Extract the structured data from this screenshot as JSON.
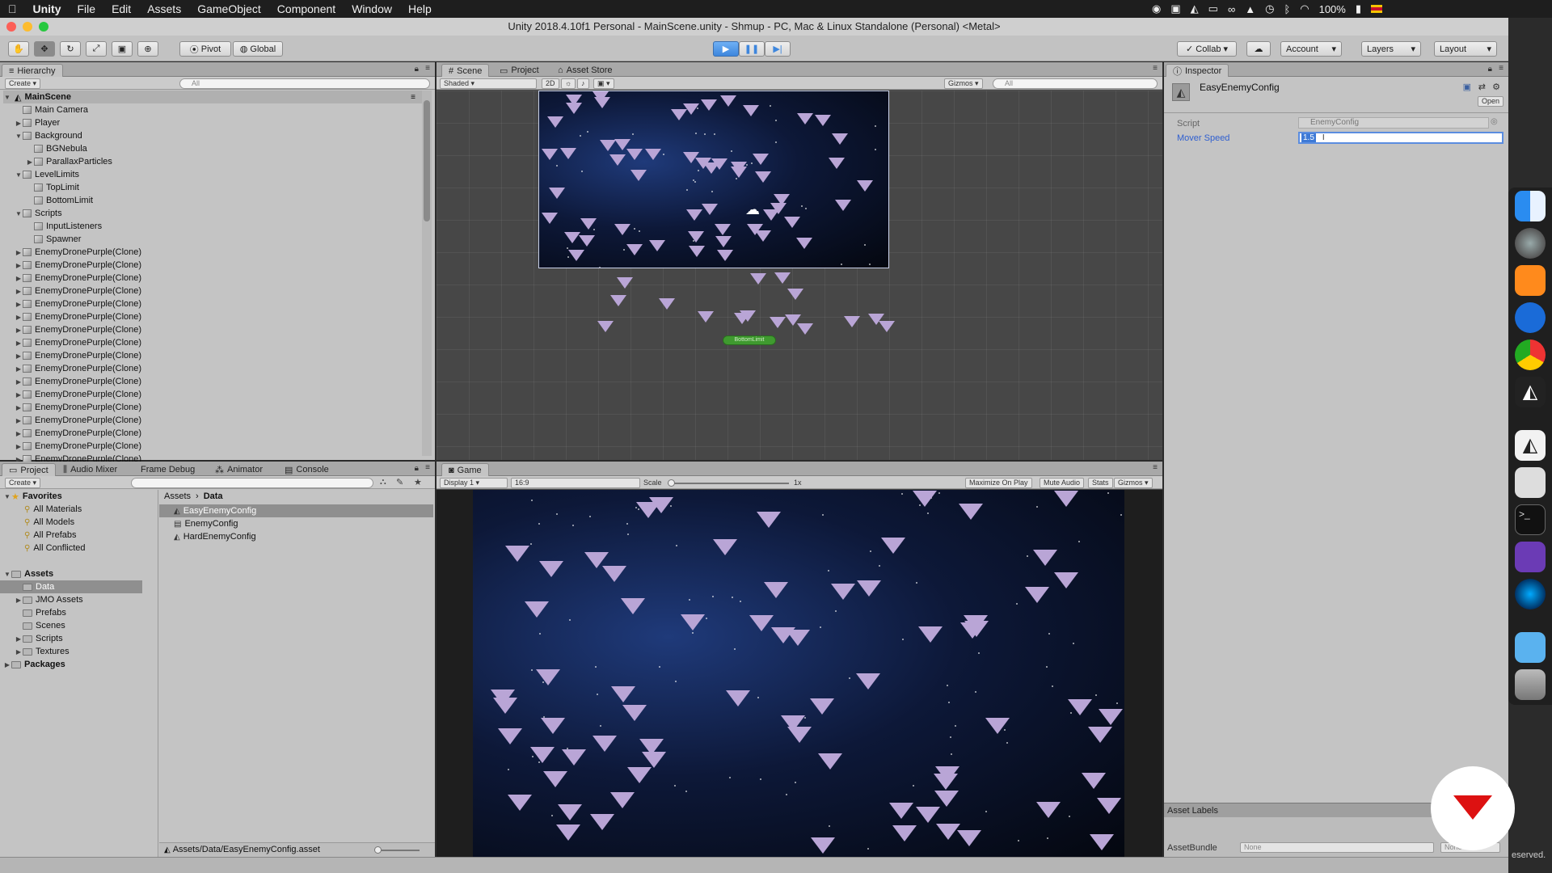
{
  "menubar": {
    "app": "Unity",
    "items": [
      "File",
      "Edit",
      "Assets",
      "GameObject",
      "Component",
      "Window",
      "Help"
    ],
    "battery": "100%"
  },
  "window": {
    "title": "Unity 2018.4.10f1 Personal - MainScene.unity - Shmup - PC, Mac & Linux Standalone (Personal) <Metal>"
  },
  "toolbar": {
    "pivot": "Pivot",
    "global": "Global",
    "collab": "Collab",
    "account": "Account",
    "layers": "Layers",
    "layout": "Layout"
  },
  "hierarchy": {
    "tab": "Hierarchy",
    "create": "Create",
    "search_placeholder": "All",
    "scene": "MainScene",
    "items": [
      {
        "label": "Main Camera",
        "depth": 1,
        "expand": ""
      },
      {
        "label": "Player",
        "depth": 1,
        "expand": "▶"
      },
      {
        "label": "Background",
        "depth": 1,
        "expand": "▼"
      },
      {
        "label": "BGNebula",
        "depth": 2,
        "expand": ""
      },
      {
        "label": "ParallaxParticles",
        "depth": 2,
        "expand": "▶"
      },
      {
        "label": "LevelLimits",
        "depth": 1,
        "expand": "▼"
      },
      {
        "label": "TopLimit",
        "depth": 2,
        "expand": ""
      },
      {
        "label": "BottomLimit",
        "depth": 2,
        "expand": ""
      },
      {
        "label": "Scripts",
        "depth": 1,
        "expand": "▼"
      },
      {
        "label": "InputListeners",
        "depth": 2,
        "expand": ""
      },
      {
        "label": "Spawner",
        "depth": 2,
        "expand": ""
      },
      {
        "label": "EnemyDronePurple(Clone)",
        "depth": 1,
        "expand": "▶"
      },
      {
        "label": "EnemyDronePurple(Clone)",
        "depth": 1,
        "expand": "▶"
      },
      {
        "label": "EnemyDronePurple(Clone)",
        "depth": 1,
        "expand": "▶"
      },
      {
        "label": "EnemyDronePurple(Clone)",
        "depth": 1,
        "expand": "▶"
      },
      {
        "label": "EnemyDronePurple(Clone)",
        "depth": 1,
        "expand": "▶"
      },
      {
        "label": "EnemyDronePurple(Clone)",
        "depth": 1,
        "expand": "▶"
      },
      {
        "label": "EnemyDronePurple(Clone)",
        "depth": 1,
        "expand": "▶"
      },
      {
        "label": "EnemyDronePurple(Clone)",
        "depth": 1,
        "expand": "▶"
      },
      {
        "label": "EnemyDronePurple(Clone)",
        "depth": 1,
        "expand": "▶"
      },
      {
        "label": "EnemyDronePurple(Clone)",
        "depth": 1,
        "expand": "▶"
      },
      {
        "label": "EnemyDronePurple(Clone)",
        "depth": 1,
        "expand": "▶"
      },
      {
        "label": "EnemyDronePurple(Clone)",
        "depth": 1,
        "expand": "▶"
      },
      {
        "label": "EnemyDronePurple(Clone)",
        "depth": 1,
        "expand": "▶"
      },
      {
        "label": "EnemyDronePurple(Clone)",
        "depth": 1,
        "expand": "▶"
      },
      {
        "label": "EnemyDronePurple(Clone)",
        "depth": 1,
        "expand": "▶"
      },
      {
        "label": "EnemyDronePurple(Clone)",
        "depth": 1,
        "expand": "▶"
      },
      {
        "label": "EnemyDronePurple(Clone)",
        "depth": 1,
        "expand": "▶"
      }
    ]
  },
  "scene": {
    "tabs": [
      "Scene",
      "Project",
      "Asset Store"
    ],
    "shading": "Shaded",
    "mode_2d": "2D",
    "gizmos": "Gizmos",
    "search_placeholder": "All",
    "bottom_limit_label": "BottomLimit"
  },
  "project": {
    "tabs": [
      "Project",
      "Audio Mixer",
      "Frame Debug",
      "Animator",
      "Console"
    ],
    "create": "Create",
    "favorites_title": "Favorites",
    "favorites": [
      "All Materials",
      "All Models",
      "All Prefabs",
      "All Conflicted"
    ],
    "assets_title": "Assets",
    "assets": [
      {
        "label": "Data",
        "expand": "",
        "selected": true
      },
      {
        "label": "JMO Assets",
        "expand": "▶",
        "selected": false
      },
      {
        "label": "Prefabs",
        "expand": "",
        "selected": false
      },
      {
        "label": "Scenes",
        "expand": "",
        "selected": false
      },
      {
        "label": "Scripts",
        "expand": "▶",
        "selected": false
      },
      {
        "label": "Textures",
        "expand": "▶",
        "selected": false
      }
    ],
    "packages": "Packages",
    "breadcrumb": [
      "Assets",
      "Data"
    ],
    "files": [
      {
        "label": "EasyEnemyConfig",
        "selected": true
      },
      {
        "label": "EnemyConfig",
        "selected": false
      },
      {
        "label": "HardEnemyConfig",
        "selected": false
      }
    ],
    "footer_path": "Assets/Data/EasyEnemyConfig.asset"
  },
  "game": {
    "tab": "Game",
    "display": "Display 1",
    "aspect": "16:9",
    "scale_label": "Scale",
    "scale_value": "1x",
    "maximize": "Maximize On Play",
    "mute": "Mute Audio",
    "stats": "Stats",
    "gizmos": "Gizmos"
  },
  "inspector": {
    "tab": "Inspector",
    "asset_name": "EasyEnemyConfig",
    "open": "Open",
    "script_label": "Script",
    "script_value": "EnemyConfig",
    "mover_speed_label": "Mover Speed",
    "mover_speed_value": "1.5",
    "asset_labels": "Asset Labels",
    "assetbundle_label": "AssetBundle",
    "assetbundle_value": "None",
    "assetbundle_variant": "None"
  },
  "watermark": "eserved.",
  "colors": {
    "selection": "#3e7ad6",
    "play_blue": "#3d86dd",
    "panel_bg": "#c4c4c4",
    "ship": "#b9a5d6",
    "space_dark": "#04070f",
    "limit_green": "#3f9a2f"
  }
}
